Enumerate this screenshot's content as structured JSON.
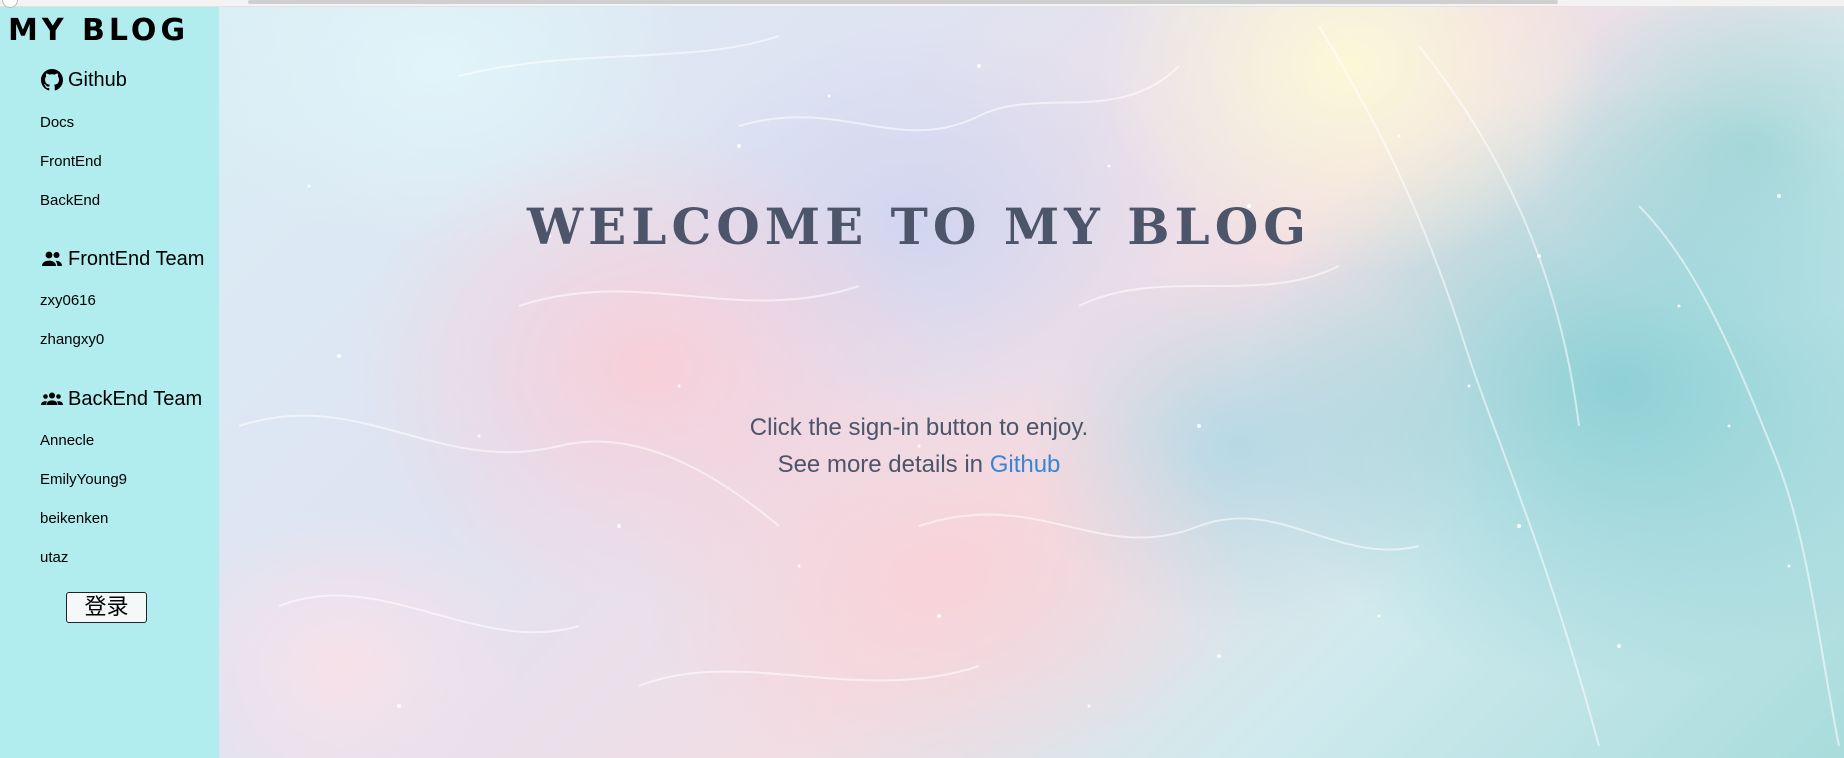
{
  "sidebar": {
    "brand": "MY BLOG",
    "github": {
      "label": "Github",
      "icon": "github-icon",
      "links": [
        "Docs",
        "FrontEnd",
        "BackEnd"
      ]
    },
    "frontend_team": {
      "label": "FrontEnd Team",
      "icon": "people-icon",
      "members": [
        "zxy0616",
        "zhangxy0"
      ]
    },
    "backend_team": {
      "label": "BackEnd Team",
      "icon": "group-icon",
      "members": [
        "Annecle",
        "EmilyYoung9",
        "beikenken",
        "utaz"
      ]
    },
    "login_label": "登录"
  },
  "main": {
    "headline": "WELCOME TO MY BLOG",
    "line1": "Click the sign-in button to enjoy.",
    "line2_prefix": "See more details in ",
    "line2_link": "Github"
  },
  "colors": {
    "sidebar_bg": "#b1ecee",
    "headline": "#4c5569",
    "link": "#3786d6"
  }
}
